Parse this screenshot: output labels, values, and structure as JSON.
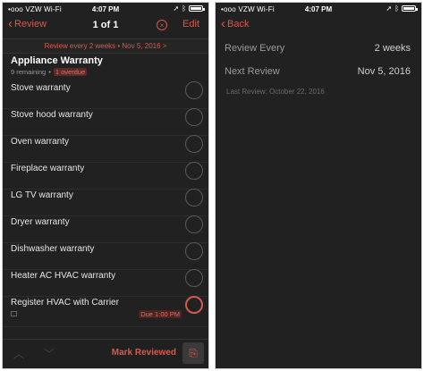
{
  "left": {
    "status": {
      "carrier": "•ooo VZW Wi-Fi",
      "time": "4:07 PM"
    },
    "nav": {
      "back_label": "Review",
      "title": "1 of 1",
      "close_glyph": "×",
      "edit_label": "Edit"
    },
    "review_bar": "Review every 2 weeks  •  Nov 5, 2016 >",
    "project": {
      "title": "Appliance Warranty",
      "remaining": "9 remaining",
      "sep": "•",
      "overdue": "1 overdue"
    },
    "tasks": [
      {
        "label": "Stove warranty"
      },
      {
        "label": "Stove hood warranty"
      },
      {
        "label": "Oven warranty"
      },
      {
        "label": "Fireplace warranty"
      },
      {
        "label": "LG TV warranty"
      },
      {
        "label": "Dryer warranty"
      },
      {
        "label": "Dishwasher warranty"
      },
      {
        "label": "Heater AC HVAC warranty"
      },
      {
        "label": "Register HVAC with Carrier",
        "due": "Due 1:00 PM"
      }
    ],
    "footer": {
      "mark_reviewed": "Mark Reviewed"
    }
  },
  "right": {
    "status": {
      "carrier": "•ooo VZW Wi-Fi",
      "time": "4:07 PM"
    },
    "nav": {
      "back_label": "Back"
    },
    "review_every": {
      "label": "Review Every",
      "value": "2 weeks"
    },
    "next_review": {
      "label": "Next Review",
      "value": "Nov 5, 2016"
    },
    "last_review": "Last Review: October 22, 2016"
  },
  "colors": {
    "accent": "#d35b4e",
    "background": "#212121"
  }
}
